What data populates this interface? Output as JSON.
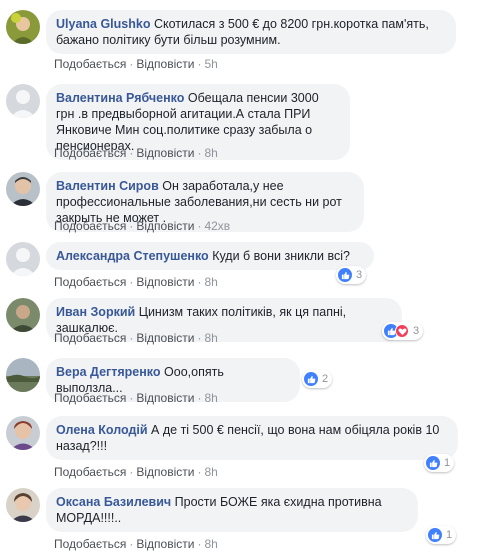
{
  "actions": {
    "like": "Подобається",
    "reply": "Відповісти",
    "sep": "·"
  },
  "comments": [
    {
      "author": "Ulyana Glushko",
      "text": "Скотилася з 500 € до 8200 грн.коротка пам'ять, бажано політику бути більш розумним.",
      "time": "5h"
    },
    {
      "author": "Валентина Рябченко",
      "text": "Обещала пенсии 3000 грн .в предвыборной агитации.А стала ПРИ Янковиче Мин соц.политике сразу забыла о пенсионерах.",
      "time": "8h"
    },
    {
      "author": "Валентин Сиров",
      "text": "Он заработала,у нее профессиональные заболевания,ни сесть ни рот закрыть не может .",
      "time": "42хв"
    },
    {
      "author": "Александра Степушенко",
      "text": "Куди б вони зникли всі?",
      "time": "8h",
      "reactions": "3"
    },
    {
      "author": "Иван Зоркий",
      "text": "Цинизм таких політиків, як ця папні, зашкалює.",
      "time": "8h",
      "reactions": "3"
    },
    {
      "author": "Вера Дегтяренко",
      "text": "Ооо,опять выползла...",
      "time": "8h",
      "reactions": "2"
    },
    {
      "author": "Олена Колодій",
      "text": "А де ті 500 € пенсії, що вона нам обіцяла років 10 назад?!!!",
      "time": "8h",
      "reactions": "1"
    },
    {
      "author": "Оксана Базилевич",
      "text": "Прости БОЖЕ яка єхидна противна МОРДА!!!!..",
      "time": "8h",
      "reactions": "1"
    }
  ],
  "colors": {
    "author": "#385898",
    "bubble": "#f2f3f5",
    "like": "#4080ff",
    "love": "#f33e58"
  }
}
